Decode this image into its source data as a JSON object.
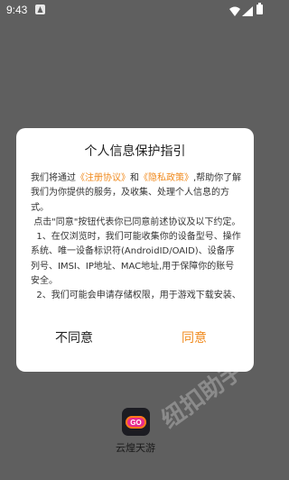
{
  "status_bar": {
    "time": "9:43",
    "icons": [
      "notification-icon",
      "wifi-icon",
      "signal-icon",
      "battery-icon"
    ]
  },
  "dialog": {
    "title": "个人信息保护指引",
    "body": {
      "p1_prefix": "我们将通过",
      "link_register": "《注册协议》",
      "p1_and": "和",
      "link_privacy": "《隐私政策》",
      "p1_suffix": ",帮助你了解我们为你提供的服务，及收集、处理个人信息的方式。",
      "p2": "点击\"同意\"按钮代表你已同意前述协议及以下约定。",
      "p3": "1、在仅浏览时，我们可能收集你的设备型号、操作系统、唯一设备标识符(AndroidID/OAID)、设备序列号、IMSI、IP地址、MAC地址,用于保障你的账号安全。",
      "p4": "2、我们可能会申请存储权限，用于游戏下载安装、缓存及删除游戏、更换头像。"
    },
    "buttons": {
      "disagree": "不同意",
      "agree": "同意"
    }
  },
  "app": {
    "name": "云煌天游",
    "icon_text": "GO"
  },
  "watermark": "纽扣助手",
  "colors": {
    "accent": "#f08a1d",
    "overlay": "#5f5f5f",
    "dialog_bg": "#ffffff"
  }
}
